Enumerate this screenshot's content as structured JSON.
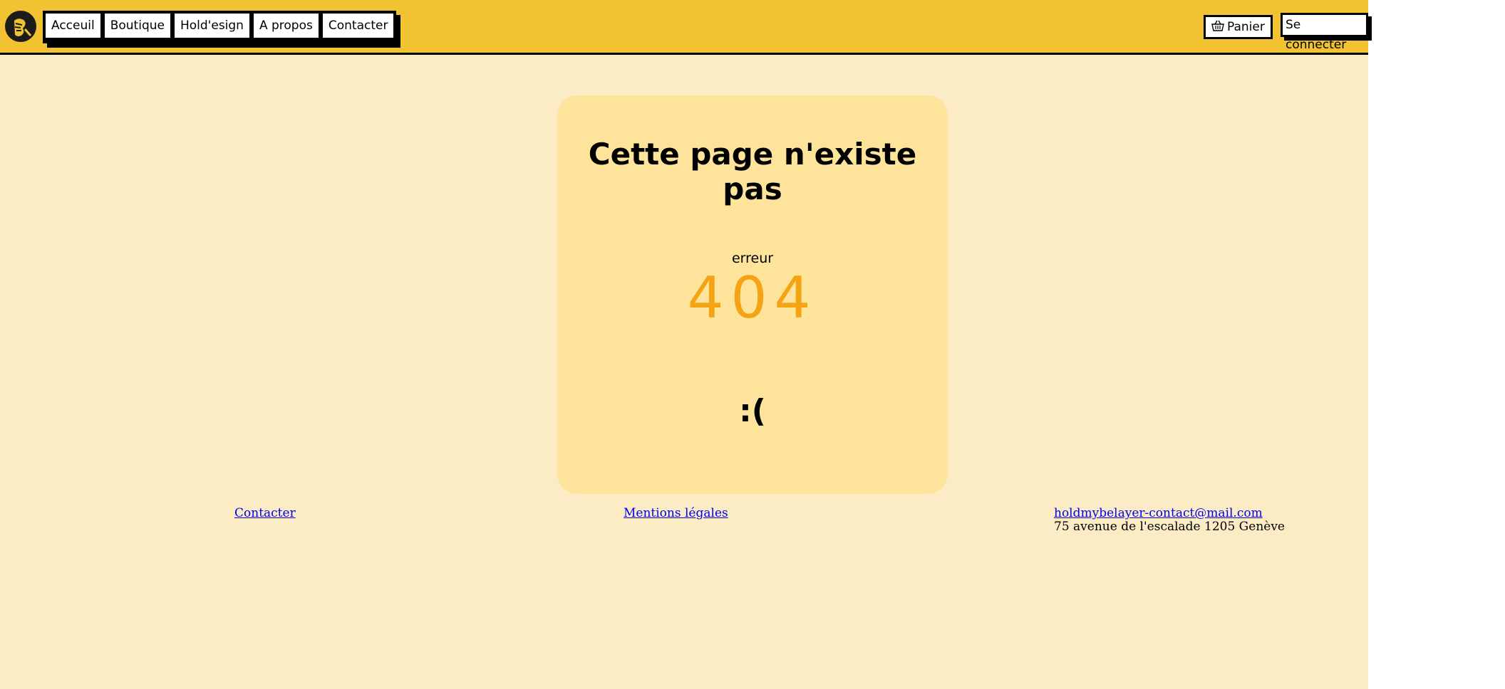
{
  "header": {
    "nav": [
      "Acceuil",
      "Boutique",
      "Hold'esign",
      "A propos",
      "Contacter"
    ],
    "cart_label": "Panier",
    "login_label": "Se connecter"
  },
  "main": {
    "title": "Cette page n'existe pas",
    "error_label": "erreur",
    "error_code": "404",
    "face": ":("
  },
  "footer": {
    "contact": "Contacter",
    "legal": "Mentions légales",
    "email": "holdmybelayer-contact@mail.com",
    "address": "75 avenue de l'escalade 1205 Genève"
  },
  "colors": {
    "header_bg": "#f1c232",
    "page_bg": "#fbecc6",
    "card_bg": "#fee49a",
    "error_code": "#f4a312"
  },
  "icons": [
    "logo-climber-icon",
    "basket-icon"
  ]
}
